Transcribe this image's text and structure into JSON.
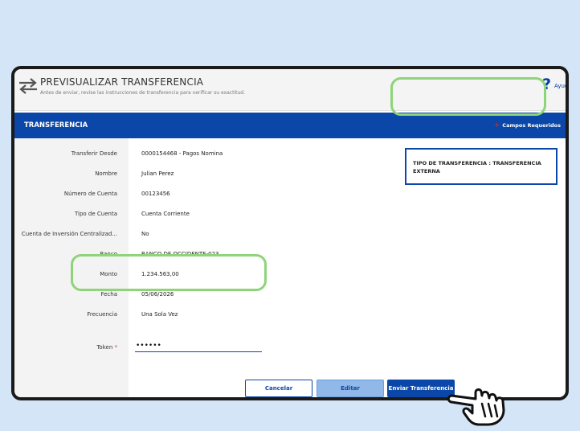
{
  "header": {
    "title": "PREVISUALIZAR TRANSFERENCIA",
    "subtitle": "Antes de enviar, revise las instrucciones de transferencia para verificar su exactitud.",
    "help_icon": "?",
    "help_label": "Ayuda"
  },
  "section": {
    "title": "TRANSFERENCIA",
    "required_icon": "+",
    "required_label": "Campos Requeridos"
  },
  "fields": [
    {
      "label": "Transferir Desde",
      "value": "0000154468 - Pagos Nomina"
    },
    {
      "label": "Nombre",
      "value": "Julian Perez"
    },
    {
      "label": "Número de Cuenta",
      "value": "00123456"
    },
    {
      "label": "Tipo de Cuenta",
      "value": "Cuenta Corriente"
    },
    {
      "label": "Cuenta de Inversión Centralizad...",
      "value": "No"
    },
    {
      "label": "Banco",
      "value": "BANCO DE OCCIDENTE-023"
    },
    {
      "label": "Monto",
      "value": "1.234.563,00"
    },
    {
      "label": "Fecha",
      "value": "05/06/2026"
    },
    {
      "label": "Frecuencia",
      "value": "Una Sola Vez"
    }
  ],
  "info_box": {
    "text": "TIPO DE TRANSFERENCIA : TRANSFERENCIA EXTERNA"
  },
  "token": {
    "label": "Token",
    "required_mark": "*",
    "value": "••••••"
  },
  "buttons": {
    "cancel": "Cancelar",
    "edit": "Editar",
    "send": "Enviar Transferencia"
  },
  "colors": {
    "background": "#d3e5f7",
    "accent": "#0b47a8",
    "highlight": "#8ed47a",
    "required": "#cf3030"
  },
  "icons": {
    "swap": "swap-arrows-icon",
    "help": "question-mark-icon",
    "cursor": "pointing-hand-icon"
  }
}
